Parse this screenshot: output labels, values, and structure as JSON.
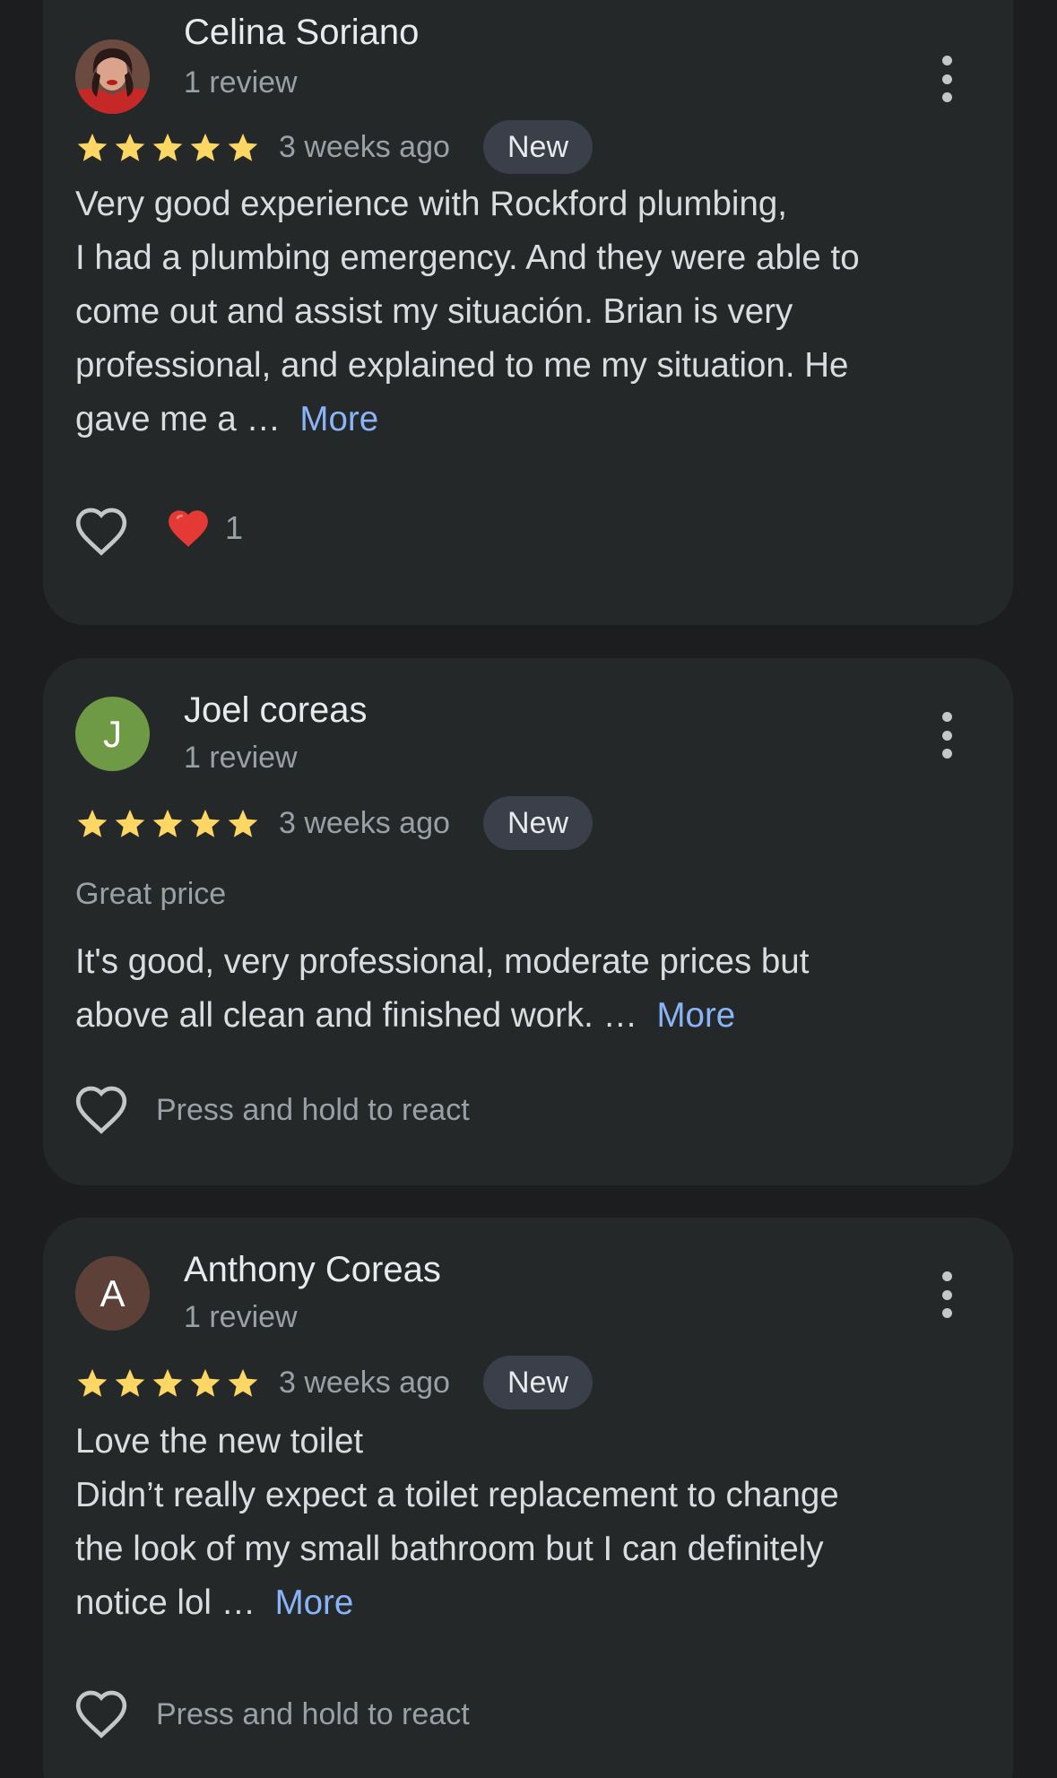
{
  "colors": {
    "background": "#1c1d1f",
    "card": "#252829",
    "star": "#fdd663",
    "link": "#8ab4f8",
    "badge_bg": "#3b3f4a"
  },
  "reviews": [
    {
      "reviewer_name": "Celina Soriano",
      "review_count": "1 review",
      "avatar": {
        "type": "photo",
        "icon": "profile-photo"
      },
      "rating": 5,
      "date": "3 weeks ago",
      "badge": "New",
      "body_lines": [
        "Very good experience with Rockford plumbing,",
        "I had a plumbing emergency. And they were able to",
        "come out and assist my situación. Brian is very",
        "professional, and explained to me my situation. He",
        "gave me a"
      ],
      "ellipsis": "…",
      "more_label": "More",
      "reaction_count": "1"
    },
    {
      "reviewer_name": "Joel coreas",
      "review_count": "1 review",
      "avatar": {
        "type": "initial",
        "letter": "J",
        "color": "#6f9a45"
      },
      "rating": 5,
      "date": "3 weeks ago",
      "badge": "New",
      "subtitle": "Great price",
      "body_lines": [
        "It's good, very professional, moderate prices but",
        "above all clean and finished work."
      ],
      "ellipsis": "…",
      "more_label": "More",
      "react_prompt": "Press and hold to react"
    },
    {
      "reviewer_name": "Anthony Coreas",
      "review_count": "1 review",
      "avatar": {
        "type": "initial",
        "letter": "A",
        "color": "#5d4037"
      },
      "rating": 5,
      "date": "3 weeks ago",
      "badge": "New",
      "body_lines": [
        "Love the new toilet",
        "Didn’t really expect a toilet replacement to change",
        "the look of my small bathroom but I can definitely",
        "notice lol"
      ],
      "ellipsis": "…",
      "more_label": "More",
      "react_prompt": "Press and hold to react"
    }
  ]
}
